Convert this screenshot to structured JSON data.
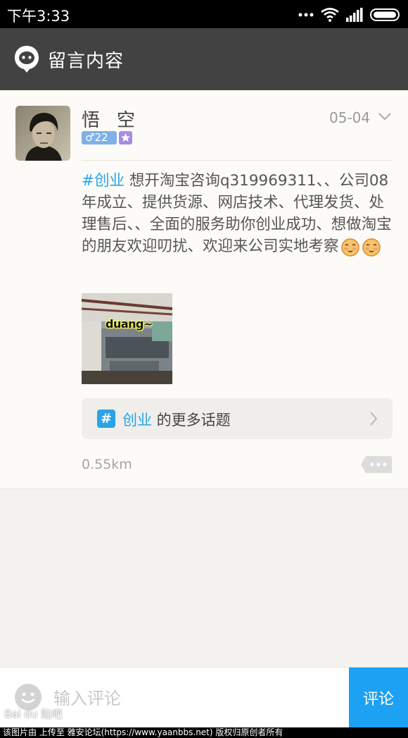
{
  "status_bar": {
    "time": "下午3:33",
    "icons": [
      "more-dots-icon",
      "wifi-icon",
      "signal-icon",
      "battery-icon"
    ]
  },
  "header": {
    "title": "留言内容",
    "logo_icon": "chat-bubble-icon"
  },
  "post": {
    "username": "悟空",
    "gender_age": "♂22",
    "date": "05-04",
    "hashtag": "#创业",
    "text": " 想开淘宝咨询q319969311、、公司08年成立、提供货源、网店技术、代理发货、处理售后、、全面的服务助你创业成功、想做淘宝的朋友欢迎叨扰、欢迎来公司实地考察",
    "image_caption": "duang~",
    "topic_hashtag": "创业",
    "topic_suffix": " 的更多话题",
    "topic_hash_symbol": "#",
    "distance": "0.55km"
  },
  "comment_bar": {
    "placeholder": "输入评论",
    "submit_label": "评论"
  },
  "watermark": "Bai du 贴吧",
  "credit": "该图片由 上传至 雅安论坛(https://www.yaanbbs.net) 版权归原创者所有",
  "colors": {
    "accent": "#2aa3e8",
    "header_bg": "#424242",
    "submit_bg": "#1da1f2"
  }
}
